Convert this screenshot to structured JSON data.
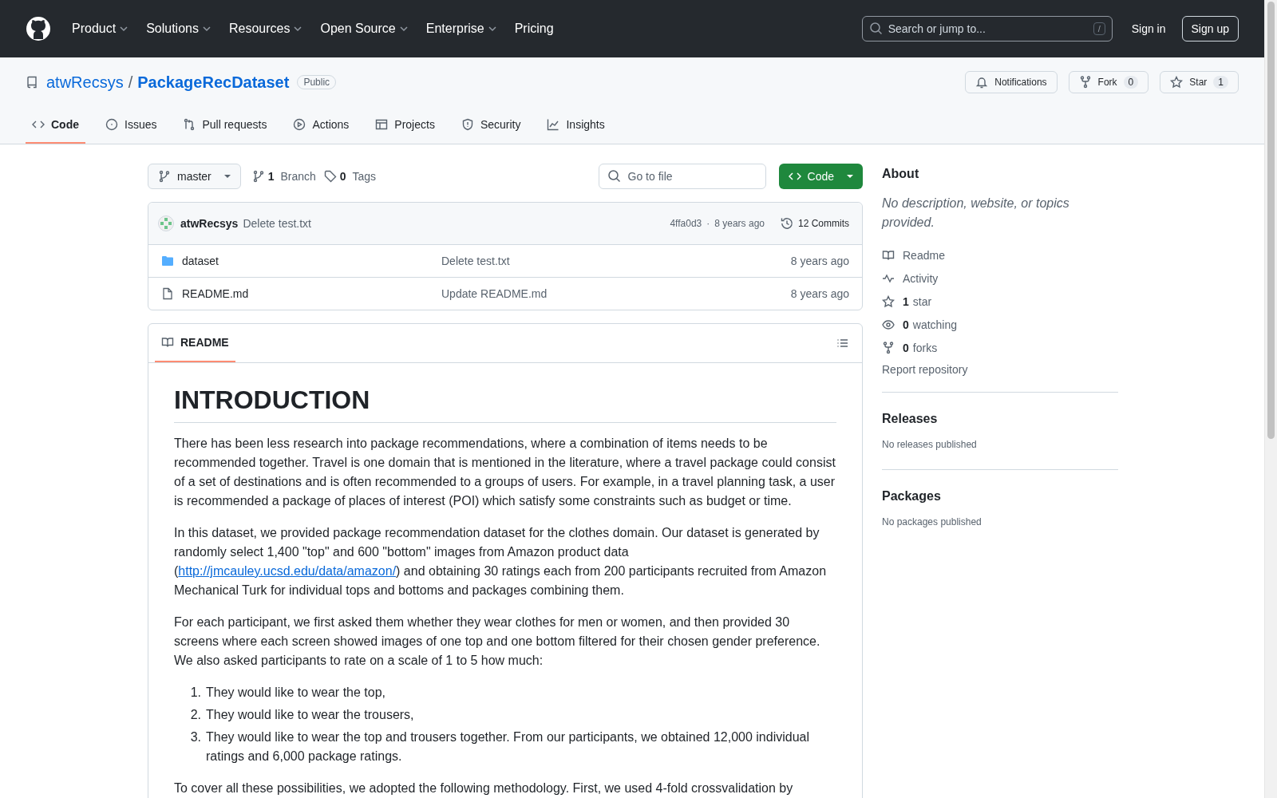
{
  "header": {
    "nav": [
      {
        "label": "Product",
        "dropdown": true
      },
      {
        "label": "Solutions",
        "dropdown": true
      },
      {
        "label": "Resources",
        "dropdown": true
      },
      {
        "label": "Open Source",
        "dropdown": true
      },
      {
        "label": "Enterprise",
        "dropdown": true
      },
      {
        "label": "Pricing",
        "dropdown": false
      }
    ],
    "search": {
      "placeholder": "Search or jump to...",
      "shortcut": "/"
    },
    "sign_in": "Sign in",
    "sign_up": "Sign up"
  },
  "repo": {
    "owner": "atwRecsys",
    "separator": "/",
    "name": "PackageRecDataset",
    "visibility": "Public",
    "actions": [
      {
        "kind": "bell",
        "label": "Notifications"
      },
      {
        "kind": "fork",
        "label": "Fork",
        "count": "0"
      },
      {
        "kind": "star",
        "label": "Star",
        "count": "1"
      }
    ]
  },
  "tabs": [
    {
      "label": "Code",
      "selected": true
    },
    {
      "label": "Issues",
      "selected": false
    },
    {
      "label": "Pull requests",
      "selected": false
    },
    {
      "label": "Actions",
      "selected": false
    },
    {
      "label": "Projects",
      "selected": false
    },
    {
      "label": "Security",
      "selected": false
    },
    {
      "label": "Insights",
      "selected": false
    }
  ],
  "toolbar": {
    "branch": "master",
    "branch_count": "1",
    "branch_label": "Branch",
    "tag_count": "0",
    "tag_label": "Tags",
    "go_to_file": {
      "placeholder": "Go to file"
    },
    "code_button": "Code"
  },
  "commit": {
    "author": "atwRecsys",
    "message": "Delete test.txt",
    "hash": "4ffa0d3",
    "separator": "·",
    "age": "8 years ago",
    "commits": "12 Commits"
  },
  "files": [
    {
      "kind": "folder",
      "name": "dataset",
      "message": "Delete test.txt",
      "age": "8 years ago"
    },
    {
      "kind": "file",
      "name": "README.md",
      "message": "Update README.md",
      "age": "8 years ago"
    }
  ],
  "readme": {
    "tab": "README",
    "heading": "INTRODUCTION",
    "blocks": [
      {
        "kind": "paragraph",
        "text": "There has been less research into package recommendations, where a combination of items needs to be recommended together. Travel is one domain that is mentioned in the literature, where a travel package could consist of a set of destinations and is often recommended to a groups of users. For example, in a travel planning task, a user is recommended a package of places of interest (POI) which satisfy some constraints such as budget or time."
      },
      {
        "kind": "link_paragraph",
        "before": "In this dataset, we provided package recommendation dataset for the clothes domain. Our dataset is generated by randomly select 1,400 \"top\" and 600 \"bottom\" images from Amazon product data (",
        "link": "http://jmcauley.ucsd.edu/data/amazon/",
        "after": ") and obtaining 30 ratings each from 200 participants recruited from Amazon Mechanical Turk for individual tops and bottoms and packages combining them."
      },
      {
        "kind": "paragraph",
        "text": "For each participant, we first asked them whether they wear clothes for men or women, and then provided 30 screens where each screen showed images of one top and one bottom filtered for their chosen gender preference. We also asked participants to rate on a scale of 1 to 5 how much:"
      },
      {
        "kind": "list",
        "items": [
          {
            "number": "1.",
            "text": "They would like to wear the top,"
          },
          {
            "number": "2.",
            "text": "They would like to wear the trousers,"
          },
          {
            "number": "3.",
            "text": "They would like to wear the top and trousers together. From our participants, we obtained 12,000 individual ratings and 6,000 package ratings."
          }
        ]
      },
      {
        "kind": "paragraph",
        "text": "To cover all these possibilities, we adopted the following methodology. First, we used 4-fold crossvalidation by"
      }
    ]
  },
  "sidebar": {
    "about": {
      "title": "About",
      "description": "No description, website, or topics provided.",
      "links": [
        {
          "label": "Readme"
        },
        {
          "label": "Activity"
        },
        {
          "count": "1",
          "label": "star"
        },
        {
          "count": "0",
          "label": "watching"
        },
        {
          "count": "0",
          "label": "forks"
        }
      ],
      "report": "Report repository"
    },
    "sections": [
      {
        "title": "Releases",
        "text": "No releases published"
      },
      {
        "title": "Packages",
        "text": "No packages published"
      }
    ]
  }
}
